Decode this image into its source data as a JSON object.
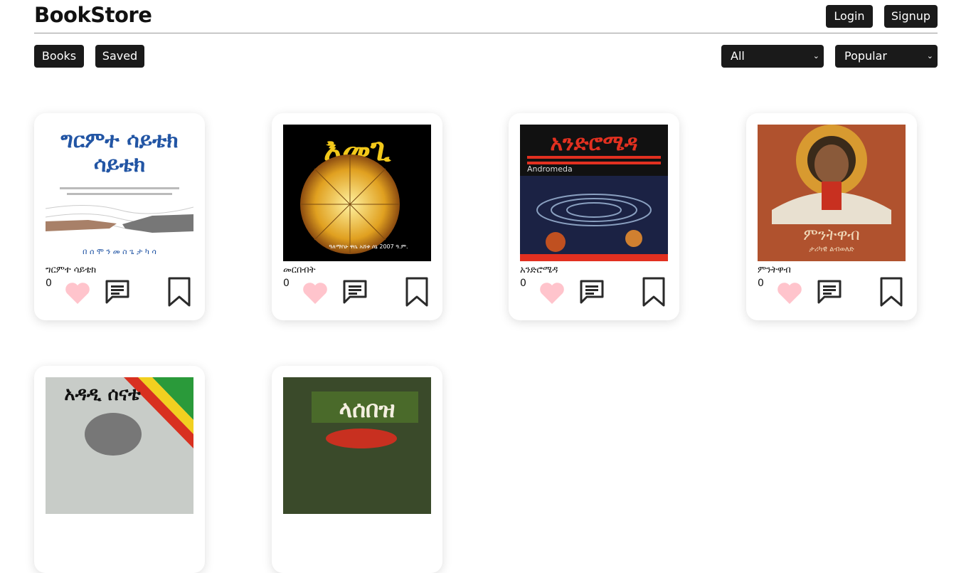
{
  "header": {
    "brand": "BookStore",
    "login_label": "Login",
    "signup_label": "Signup"
  },
  "nav": {
    "books_label": "Books",
    "saved_label": "Saved"
  },
  "filters": {
    "category_selected": "All",
    "sort_selected": "Popular"
  },
  "colors": {
    "button_bg": "#1a1a1a",
    "heart": "#ffc4cc",
    "icon_stroke": "#2a2a2a"
  },
  "books": [
    {
      "title": "ግርምተ ሳይቴክ",
      "likes": "0",
      "cover_text": "ግርምተ ሳይቴክ",
      "cover_footer": "በ ሰ ሞ ን  መ ስ ጌ ታ  ካ ሳ"
    },
    {
      "title": "መርበብት",
      "likes": "0",
      "cover_text": "እመጊ",
      "cover_footer": "ዓለማየሁ ዋሴ አሸቱ  ሰኔ 2007 ዓ.ም."
    },
    {
      "title": "አንድሮሜዳ",
      "likes": "0",
      "cover_text": "አንድሮሜዳ",
      "cover_sub": "Andromeda"
    },
    {
      "title": "ምንትዋብ",
      "likes": "0",
      "cover_text": "ምንትዋብ",
      "cover_sub": "ታሪካዊ ልብወለድ"
    },
    {
      "title": "",
      "likes": "",
      "cover_text": "አዳዲ ሰናቴ"
    },
    {
      "title": "",
      "likes": "",
      "cover_text": "ላሰበዝ"
    }
  ]
}
